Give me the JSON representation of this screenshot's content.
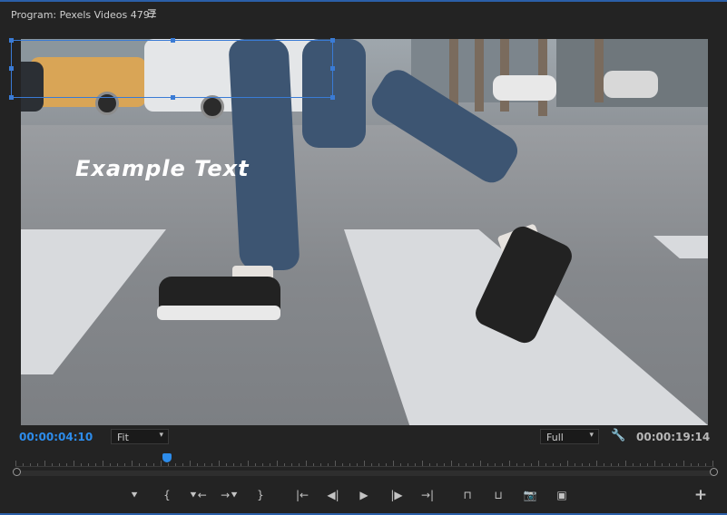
{
  "panel": {
    "title": "Program: Pexels Videos 4797",
    "menu_icon": "hamburger-menu-icon"
  },
  "viewer": {
    "overlay_text": "Example Text"
  },
  "controls": {
    "current_timecode": "00:00:04:10",
    "zoom_value": "Fit",
    "resolution_value": "Full",
    "duration_timecode": "00:00:19:14",
    "settings_icon": "wrench-icon"
  },
  "transport": {
    "buttons": [
      {
        "name": "add-marker-button",
        "glyph": "⯆"
      },
      {
        "name": "mark-in-button",
        "glyph": "{"
      },
      {
        "name": "go-to-in-button",
        "glyph": "⯆←"
      },
      {
        "name": "go-to-out-button",
        "glyph": "→⯆"
      },
      {
        "name": "mark-out-button",
        "glyph": "}"
      },
      {
        "name": "go-to-in-point-button",
        "glyph": "|←"
      },
      {
        "name": "step-back-button",
        "glyph": "◀|"
      },
      {
        "name": "play-button",
        "glyph": "▶"
      },
      {
        "name": "step-forward-button",
        "glyph": "|▶"
      },
      {
        "name": "go-to-out-point-button",
        "glyph": "→|"
      },
      {
        "name": "lift-button",
        "glyph": "⊓"
      },
      {
        "name": "extract-button",
        "glyph": "⊔"
      },
      {
        "name": "export-frame-button",
        "glyph": "📷"
      },
      {
        "name": "compare-view-button",
        "glyph": "▣"
      },
      {
        "name": "add-button",
        "glyph": "+"
      }
    ]
  },
  "colors": {
    "accent": "#2d8ceb",
    "panel_bg": "#232323"
  }
}
